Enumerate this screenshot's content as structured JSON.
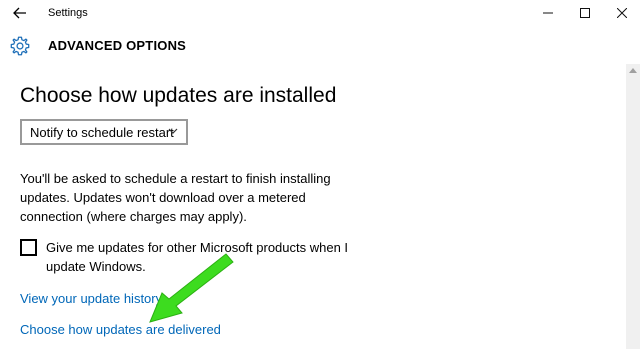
{
  "window": {
    "title": "Settings",
    "back_icon": "back-arrow-icon",
    "controls": [
      "minimize-icon",
      "maximize-icon",
      "close-icon"
    ]
  },
  "header": {
    "icon": "gear-icon",
    "title": "ADVANCED OPTIONS"
  },
  "main": {
    "heading": "Choose how updates are installed",
    "dropdown": {
      "selected": "Notify to schedule restart"
    },
    "description": "You'll be asked to schedule a restart to finish installing updates. Updates won't download over a metered connection (where charges may apply).",
    "checkbox": {
      "label": "Give me updates for other Microsoft products when I update Windows.",
      "checked": false
    },
    "links": {
      "history": "View your update history",
      "delivered": "Choose how updates are delivered"
    }
  },
  "annotation": {
    "arrow_color": "#3ddc1f"
  },
  "colors": {
    "accent": "#0067b8",
    "gear": "#1e6fb8"
  }
}
